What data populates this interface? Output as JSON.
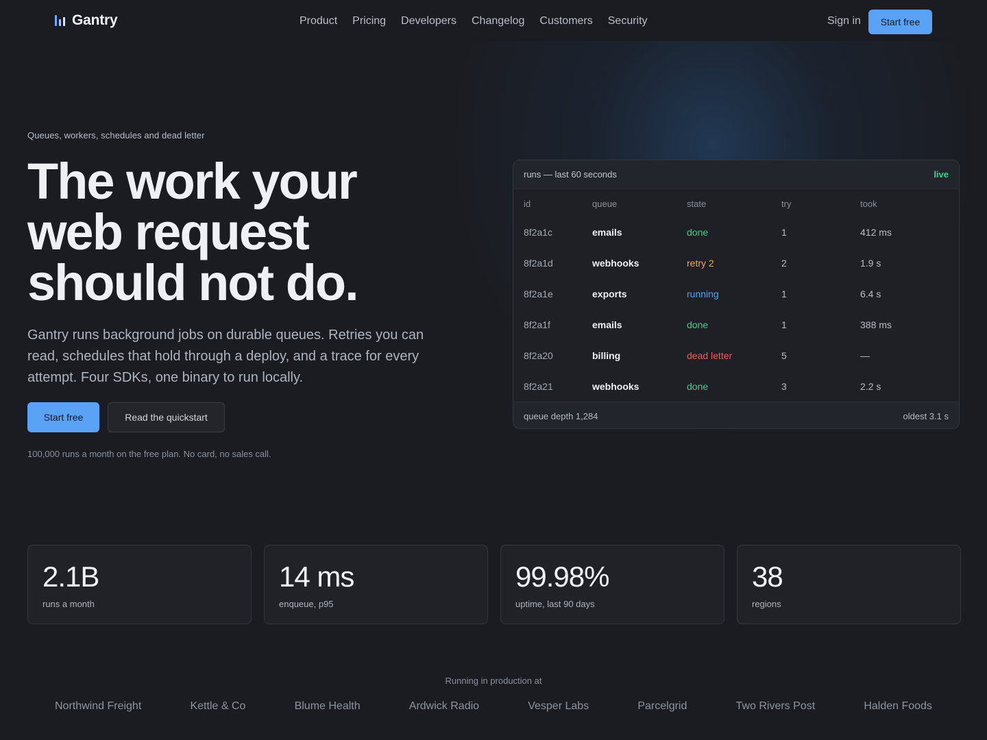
{
  "brand": {
    "name": "Gantry"
  },
  "nav": {
    "links": [
      "Product",
      "Pricing",
      "Developers",
      "Changelog",
      "Customers",
      "Security"
    ],
    "signin": "Sign in",
    "cta": "Start free"
  },
  "hero": {
    "eyebrow": "Queues, workers, schedules and dead letter",
    "headline": [
      "The work your",
      "web request",
      "should not do."
    ],
    "lede": "Gantry runs background jobs on durable queues. Retries you can read, schedules that hold through a deploy, and a trace for every attempt. Four SDKs, one binary to run locally.",
    "primary_cta": "Start free",
    "secondary_cta": "Read the quickstart",
    "fineprint": "100,000 runs a month on the free plan. No card, no sales call."
  },
  "runs_panel": {
    "title": "runs — last 60 seconds",
    "status": "live",
    "columns": [
      "id",
      "queue",
      "state",
      "try",
      "took"
    ],
    "rows": [
      {
        "id": "8f2a1c",
        "queue": "emails",
        "state": "done",
        "try": "1",
        "took": "412 ms"
      },
      {
        "id": "8f2a1d",
        "queue": "webhooks",
        "state": "retry 2",
        "try": "2",
        "took": "1.9 s"
      },
      {
        "id": "8f2a1e",
        "queue": "exports",
        "state": "running",
        "try": "1",
        "took": "6.4 s"
      },
      {
        "id": "8f2a1f",
        "queue": "emails",
        "state": "done",
        "try": "1",
        "took": "388 ms"
      },
      {
        "id": "8f2a20",
        "queue": "billing",
        "state": "dead letter",
        "try": "5",
        "took": "—"
      },
      {
        "id": "8f2a21",
        "queue": "webhooks",
        "state": "done",
        "try": "3",
        "took": "2.2 s"
      }
    ],
    "state_colors": {
      "done": "#3fcf8e",
      "retry": "#f0a847",
      "running": "#5aa2f6",
      "dead letter": "#ef5b5b"
    },
    "footer_left": "queue depth 1,284",
    "footer_right": "oldest 3.1 s"
  },
  "stats": [
    {
      "value": "2.1B",
      "label": "runs a month"
    },
    {
      "value": "14 ms",
      "label": "enqueue, p95"
    },
    {
      "value": "99.98%",
      "label": "uptime, last 90 days"
    },
    {
      "value": "38",
      "label": "regions"
    }
  ],
  "customers": {
    "label": "Running in production at",
    "names": [
      "Northwind Freight",
      "Kettle & Co",
      "Blume Health",
      "Ardwick Radio",
      "Vesper Labs",
      "Parcelgrid",
      "Two Rivers Post",
      "Halden Foods"
    ]
  },
  "colors": {
    "accent": "#5aa2f6",
    "background": "#1b1c21",
    "live": "#3fcf8e"
  }
}
